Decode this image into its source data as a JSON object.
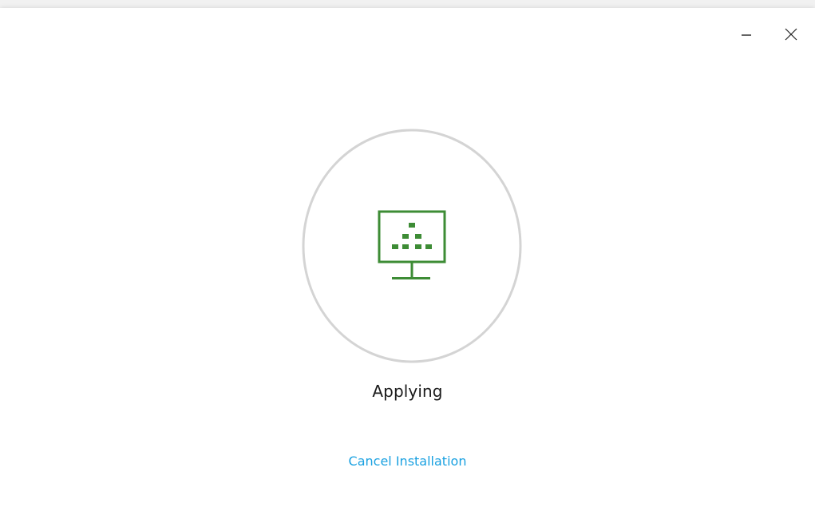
{
  "window": {
    "minimize_icon": "minimize-icon",
    "close_icon": "close-icon"
  },
  "progress": {
    "icon": "monitor-pyramid-icon",
    "status": "Applying",
    "accent_color": "#3d8c35",
    "ring_color": "#d4d4d4"
  },
  "actions": {
    "cancel_label": "Cancel Installation",
    "link_color": "#1aa1e1"
  }
}
